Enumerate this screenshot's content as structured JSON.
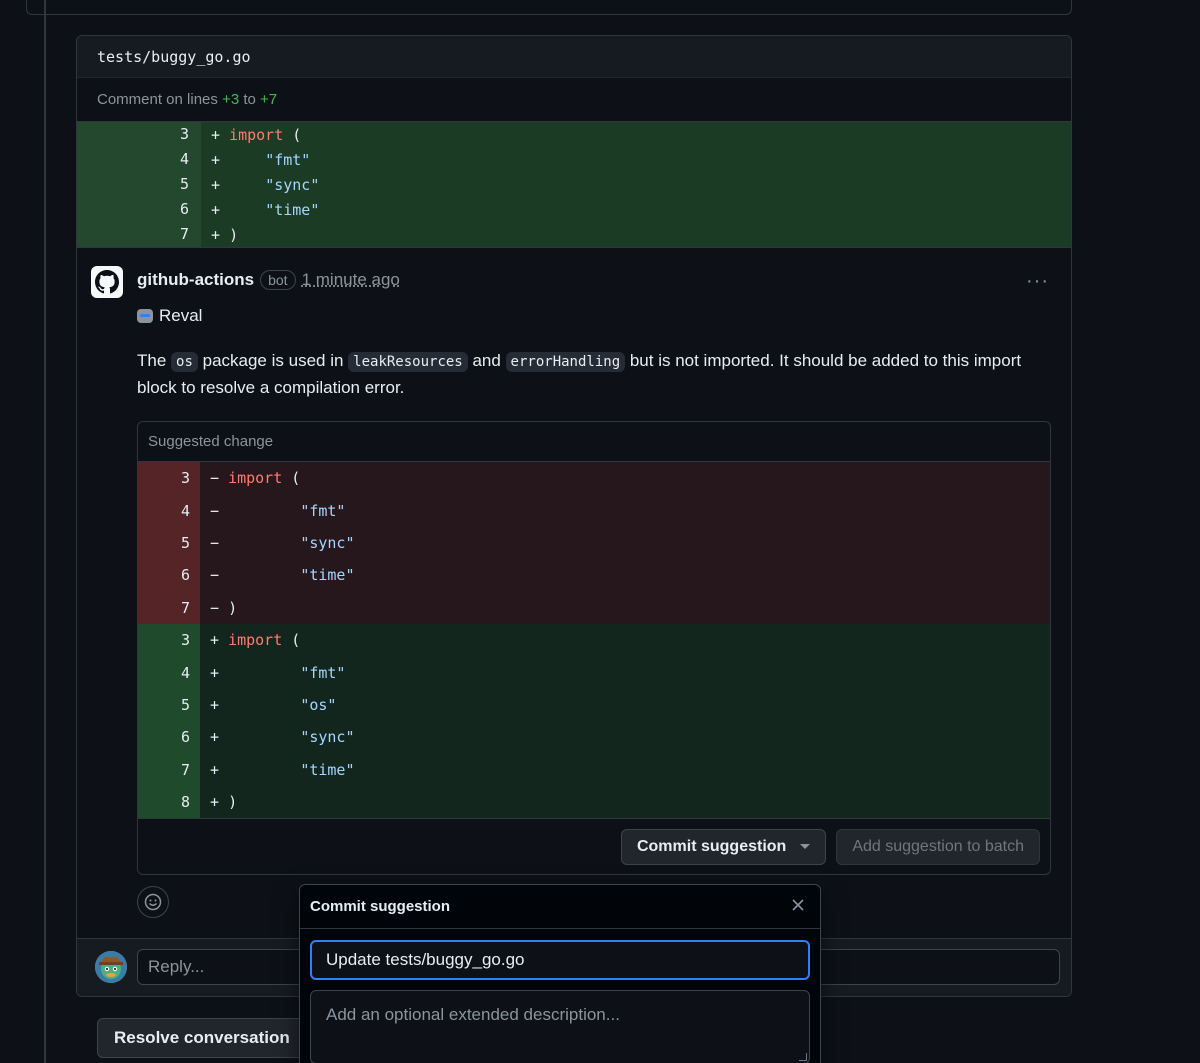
{
  "file": {
    "path": "tests/buggy_go.go"
  },
  "comment_range": {
    "prefix": "Comment on lines",
    "start": "+3",
    "joiner": "to",
    "end": "+7"
  },
  "context_lines": [
    {
      "num": "3",
      "sign": "+",
      "parts": [
        {
          "t": "kw",
          "v": "import"
        },
        {
          "t": "plain",
          "v": " ("
        }
      ]
    },
    {
      "num": "4",
      "sign": "+",
      "parts": [
        {
          "t": "plain",
          "v": "    "
        },
        {
          "t": "str",
          "v": "\"fmt\""
        }
      ]
    },
    {
      "num": "5",
      "sign": "+",
      "parts": [
        {
          "t": "plain",
          "v": "    "
        },
        {
          "t": "str",
          "v": "\"sync\""
        }
      ]
    },
    {
      "num": "6",
      "sign": "+",
      "parts": [
        {
          "t": "plain",
          "v": "    "
        },
        {
          "t": "str",
          "v": "\"time\""
        }
      ]
    },
    {
      "num": "7",
      "sign": "+",
      "parts": [
        {
          "t": "plain",
          "v": ")"
        }
      ]
    }
  ],
  "comment": {
    "author": "github-actions",
    "badge": "bot",
    "time": "1 minute ago",
    "menu": "···",
    "heading": "Reval",
    "body": [
      {
        "t": "text",
        "v": "The "
      },
      {
        "t": "code",
        "v": "os"
      },
      {
        "t": "text",
        "v": " package is used in "
      },
      {
        "t": "code",
        "v": "leakResources"
      },
      {
        "t": "text",
        "v": " and "
      },
      {
        "t": "code",
        "v": "errorHandling"
      },
      {
        "t": "text",
        "v": " but is not imported. It should be added to this import block to resolve a compilation error."
      }
    ]
  },
  "suggestion": {
    "header": "Suggested change",
    "removed": [
      {
        "num": "3",
        "sign": "−",
        "parts": [
          {
            "t": "kw",
            "v": "import"
          },
          {
            "t": "plain",
            "v": " ("
          }
        ]
      },
      {
        "num": "4",
        "sign": "−",
        "parts": [
          {
            "t": "plain",
            "v": "        "
          },
          {
            "t": "str",
            "v": "\"fmt\""
          }
        ]
      },
      {
        "num": "5",
        "sign": "−",
        "parts": [
          {
            "t": "plain",
            "v": "        "
          },
          {
            "t": "str",
            "v": "\"sync\""
          }
        ]
      },
      {
        "num": "6",
        "sign": "−",
        "parts": [
          {
            "t": "plain",
            "v": "        "
          },
          {
            "t": "str",
            "v": "\"time\""
          }
        ]
      },
      {
        "num": "7",
        "sign": "−",
        "parts": [
          {
            "t": "plain",
            "v": ")"
          }
        ]
      }
    ],
    "added": [
      {
        "num": "3",
        "sign": "+",
        "parts": [
          {
            "t": "kw",
            "v": "import"
          },
          {
            "t": "plain",
            "v": " ("
          }
        ]
      },
      {
        "num": "4",
        "sign": "+",
        "parts": [
          {
            "t": "plain",
            "v": "        "
          },
          {
            "t": "str",
            "v": "\"fmt\""
          }
        ]
      },
      {
        "num": "5",
        "sign": "+",
        "parts": [
          {
            "t": "plain",
            "v": "        "
          },
          {
            "t": "str",
            "v": "\"os\""
          }
        ]
      },
      {
        "num": "6",
        "sign": "+",
        "parts": [
          {
            "t": "plain",
            "v": "        "
          },
          {
            "t": "str",
            "v": "\"sync\""
          }
        ]
      },
      {
        "num": "7",
        "sign": "+",
        "parts": [
          {
            "t": "plain",
            "v": "        "
          },
          {
            "t": "str",
            "v": "\"time\""
          }
        ]
      },
      {
        "num": "8",
        "sign": "+",
        "parts": [
          {
            "t": "plain",
            "v": ")"
          }
        ]
      }
    ],
    "commit_label": "Commit suggestion",
    "batch_label": "Add suggestion to batch"
  },
  "reply": {
    "placeholder": "Reply..."
  },
  "resolve_label": "Resolve conversation",
  "popup": {
    "title": "Commit suggestion",
    "message_value": "Update tests/buggy_go.go",
    "description_placeholder": "Add an optional extended description..."
  },
  "colors": {
    "accent": "#2f81f7",
    "added_bg": "#12261e",
    "removed_bg": "#25171c",
    "keyword": "#ff7b72",
    "string": "#a5d6ff"
  }
}
